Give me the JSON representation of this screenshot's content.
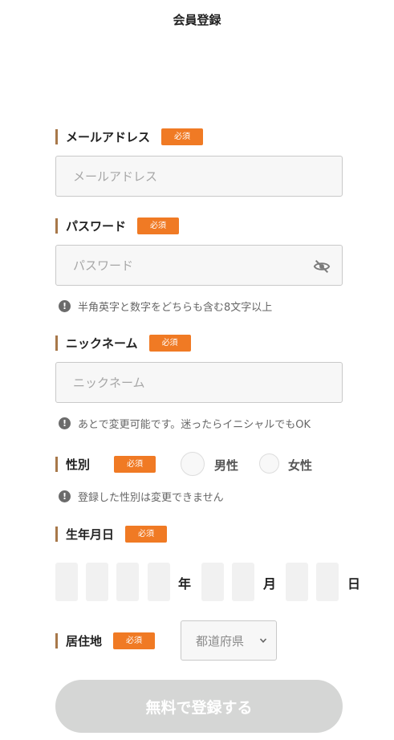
{
  "header": {
    "title": "会員登録"
  },
  "required_label": "必須",
  "email": {
    "label": "メールアドレス",
    "placeholder": "メールアドレス",
    "value": ""
  },
  "password": {
    "label": "パスワード",
    "placeholder": "パスワード",
    "value": "",
    "toggle_icon": "eye-off-icon",
    "hint": "半角英字と数字をどちらも含む8文字以上"
  },
  "nickname": {
    "label": "ニックネーム",
    "placeholder": "ニックネーム",
    "value": "",
    "hint": "あとで変更可能です。迷ったらイニシャルでもOK"
  },
  "gender": {
    "label": "性別",
    "options": [
      "男性",
      "女性"
    ],
    "selected": null,
    "hint": "登録した性別は変更できません"
  },
  "birthday": {
    "label": "生年月日",
    "year_unit": "年",
    "month_unit": "月",
    "day_unit": "日"
  },
  "residence": {
    "label": "居住地",
    "selected_display": "都道府県"
  },
  "submit_label": "無料で登録する",
  "hint_icon_glyph": "!",
  "colors": {
    "accent": "#f07a24",
    "label_bar": "#a8784a",
    "submit_disabled": "#d5d6d5",
    "input_bg": "#f7f7f7"
  }
}
